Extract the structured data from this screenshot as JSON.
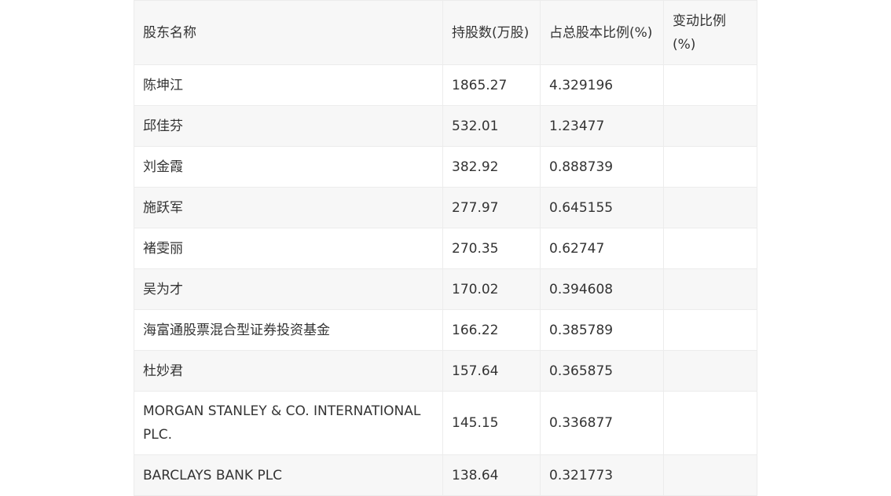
{
  "table": {
    "headers": [
      "股东名称",
      "持股数(万股)",
      "占总股本比例(%)",
      "变动比例(%)"
    ],
    "rows": [
      {
        "name": "陈坤江",
        "shares": "1865.27",
        "ratio": "4.329196",
        "change": ""
      },
      {
        "name": "邱佳芬",
        "shares": "532.01",
        "ratio": "1.23477",
        "change": ""
      },
      {
        "name": "刘金霞",
        "shares": "382.92",
        "ratio": "0.888739",
        "change": ""
      },
      {
        "name": "施跃军",
        "shares": "277.97",
        "ratio": "0.645155",
        "change": ""
      },
      {
        "name": "褚雯丽",
        "shares": "270.35",
        "ratio": "0.62747",
        "change": ""
      },
      {
        "name": "吴为才",
        "shares": "170.02",
        "ratio": "0.394608",
        "change": ""
      },
      {
        "name": "海富通股票混合型证券投资基金",
        "shares": "166.22",
        "ratio": "0.385789",
        "change": ""
      },
      {
        "name": "杜妙君",
        "shares": "157.64",
        "ratio": "0.365875",
        "change": ""
      },
      {
        "name": "MORGAN STANLEY & CO. INTERNATIONAL PLC.",
        "shares": "145.15",
        "ratio": "0.336877",
        "change": ""
      },
      {
        "name": "BARCLAYS BANK PLC",
        "shares": "138.64",
        "ratio": "0.321773",
        "change": ""
      }
    ]
  }
}
